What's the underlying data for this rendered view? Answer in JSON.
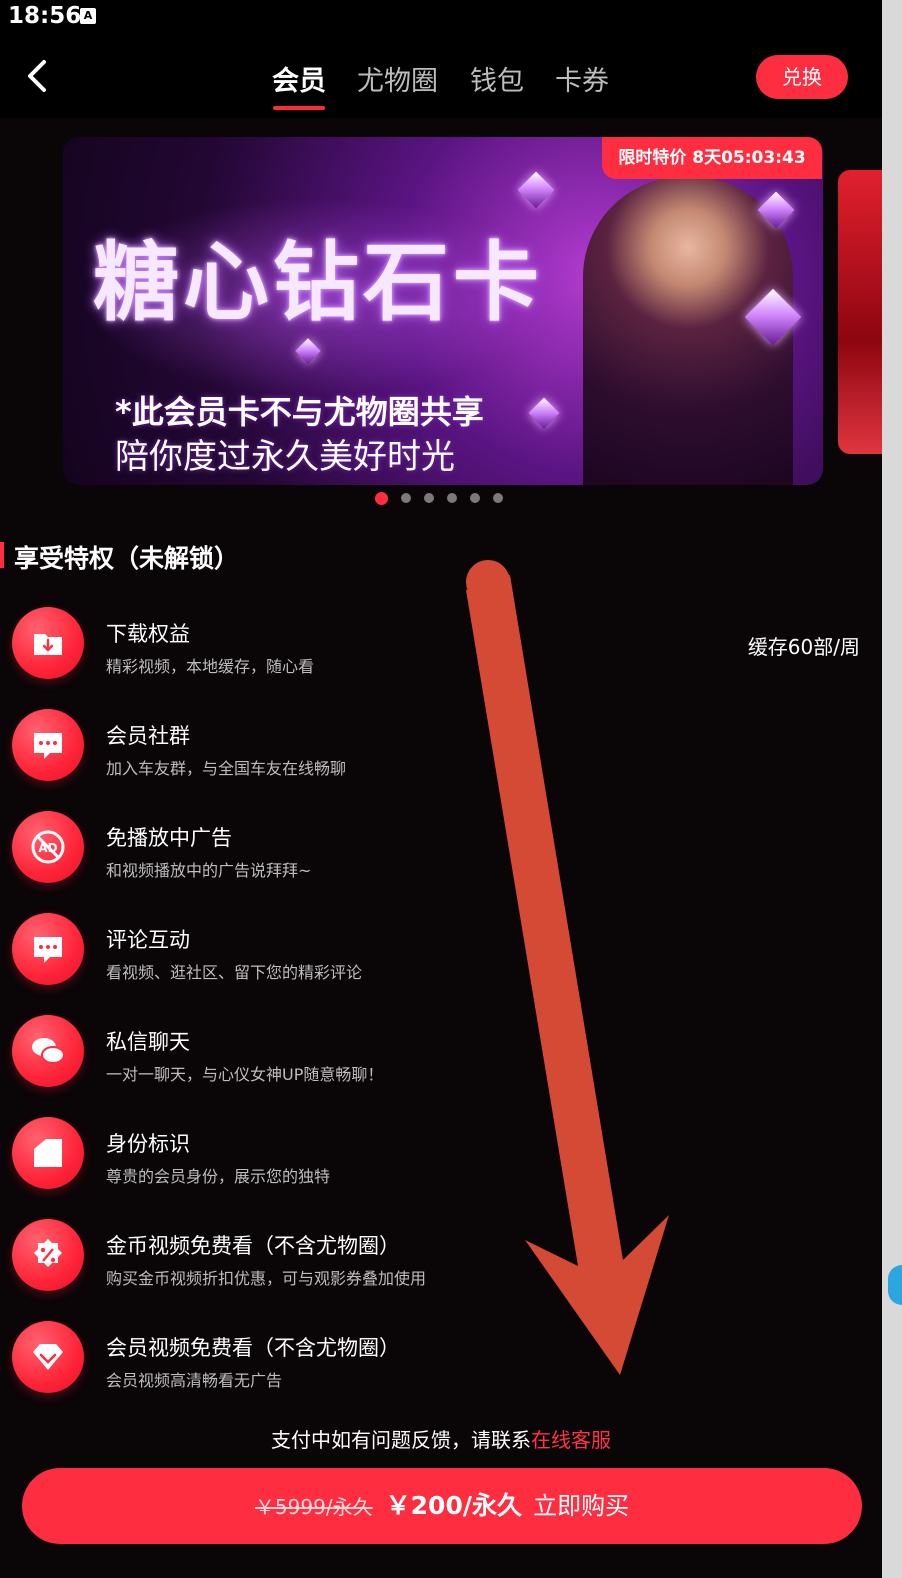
{
  "status": {
    "time": "18:56",
    "indicator": "A"
  },
  "header": {
    "tabs": [
      {
        "label": "会员",
        "active": true
      },
      {
        "label": "尤物圈",
        "active": false
      },
      {
        "label": "钱包",
        "active": false
      },
      {
        "label": "卡券",
        "active": false
      }
    ],
    "redeem_label": "兑换"
  },
  "banner": {
    "badge": "限时特价 8天05:03:43",
    "title": "糖心钻石卡",
    "subtitle1": "*此会员卡不与尤物圈共享",
    "subtitle2": "陪你度过永久美好时光",
    "page_count": 6,
    "active_index": 0
  },
  "privileges": {
    "title": "享受特权（未解锁）",
    "items": [
      {
        "icon": "download-folder-icon",
        "title": "下载权益",
        "desc": "精彩视频，本地缓存，随心看",
        "extra": "缓存60部/周"
      },
      {
        "icon": "chat-bubble-icon",
        "title": "会员社群",
        "desc": "加入车友群，与全国车友在线畅聊"
      },
      {
        "icon": "no-ads-icon",
        "title": "免播放中广告",
        "desc": "和视频播放中的广告说拜拜~"
      },
      {
        "icon": "comment-icon",
        "title": "评论互动",
        "desc": "看视频、逛社区、留下您的精彩评论"
      },
      {
        "icon": "private-message-icon",
        "title": "私信聊天",
        "desc": "一对一聊天，与心仪女神UP随意畅聊！"
      },
      {
        "icon": "identity-tag-icon",
        "title": "身份标识",
        "desc": "尊贵的会员身份，展示您的独特"
      },
      {
        "icon": "discount-badge-icon",
        "title": "金币视频免费看（不含尤物圈）",
        "desc": "购买金币视频折扣优惠，可与观影券叠加使用"
      },
      {
        "icon": "vip-diamond-icon",
        "title": "会员视频免费看（不含尤物圈）",
        "desc": "会员视频高清畅看无广告"
      }
    ]
  },
  "support": {
    "text": "支付中如有问题反馈，请联系",
    "link": "在线客服"
  },
  "purchase": {
    "old_price": "￥5999/永久",
    "new_price": "￥200/永久",
    "cta": "立即购买"
  },
  "colors": {
    "accent": "#ff2d40",
    "background": "#0a0507",
    "annotation_arrow": "#d44a35"
  }
}
